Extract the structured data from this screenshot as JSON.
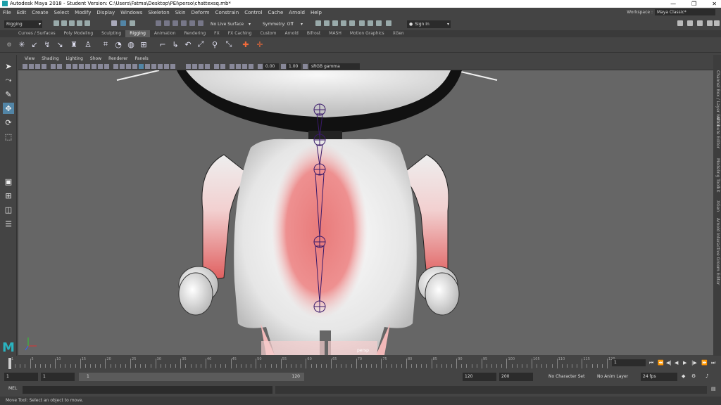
{
  "window": {
    "title": "Autodesk Maya 2018 - Student Version: C:\\Users\\Fatma\\Desktop\\PEI\\perso\\chattexsq.mb*",
    "controls": [
      "—",
      "❐",
      "✕"
    ]
  },
  "menubar": [
    "File",
    "Edit",
    "Create",
    "Select",
    "Modify",
    "Display",
    "Windows",
    "Skeleton",
    "Skin",
    "Deform",
    "Constrain",
    "Control",
    "Cache",
    "Arnold",
    "Help"
  ],
  "workspace": {
    "label": "Workspace :",
    "value": "Maya Classic*"
  },
  "statusline": {
    "menuset": "Rigging",
    "live_surface": "No Live Surface",
    "symmetry": "Symmetry: Off",
    "sign_in": "Sign In"
  },
  "shelf_tabs": {
    "items": [
      "Curves / Surfaces",
      "Poly Modeling",
      "Sculpting",
      "Rigging",
      "Animation",
      "Rendering",
      "FX",
      "FX Caching",
      "Custom",
      "Arnold",
      "Bifrost",
      "MASH",
      "Motion Graphics",
      "XGen"
    ],
    "active": "Rigging"
  },
  "panel_menu": [
    "View",
    "Shading",
    "Lighting",
    "Show",
    "Renderer",
    "Panels"
  ],
  "panel_toolbar": {
    "exposure": "0.00",
    "gamma": "1.00",
    "colorspace": "sRGB gamma"
  },
  "viewport": {
    "camera_label": "persp"
  },
  "right_tabs": [
    "Channel Box / Layer Editor",
    "Attribute Editor",
    "Modeling Toolkit",
    "XGen",
    "Arnold Interactive Groom Editor"
  ],
  "timeslider": {
    "ticks": [
      "1",
      "5",
      "10",
      "15",
      "20",
      "25",
      "30",
      "35",
      "40",
      "45",
      "50",
      "55",
      "60",
      "65",
      "70",
      "75",
      "80",
      "85",
      "90",
      "95",
      "100",
      "105",
      "110",
      "115",
      "120"
    ],
    "current_frame": "1"
  },
  "range": {
    "start": "1",
    "playback_start": "1",
    "range_slider_start": "1",
    "range_slider_end": "120",
    "playback_end": "120",
    "end": "200",
    "character_set": "No Character Set",
    "anim_layer": "No Anim Layer",
    "fps": "24 fps"
  },
  "cmdline": {
    "language": "MEL"
  },
  "help_line": "Move Tool: Select an object to move."
}
